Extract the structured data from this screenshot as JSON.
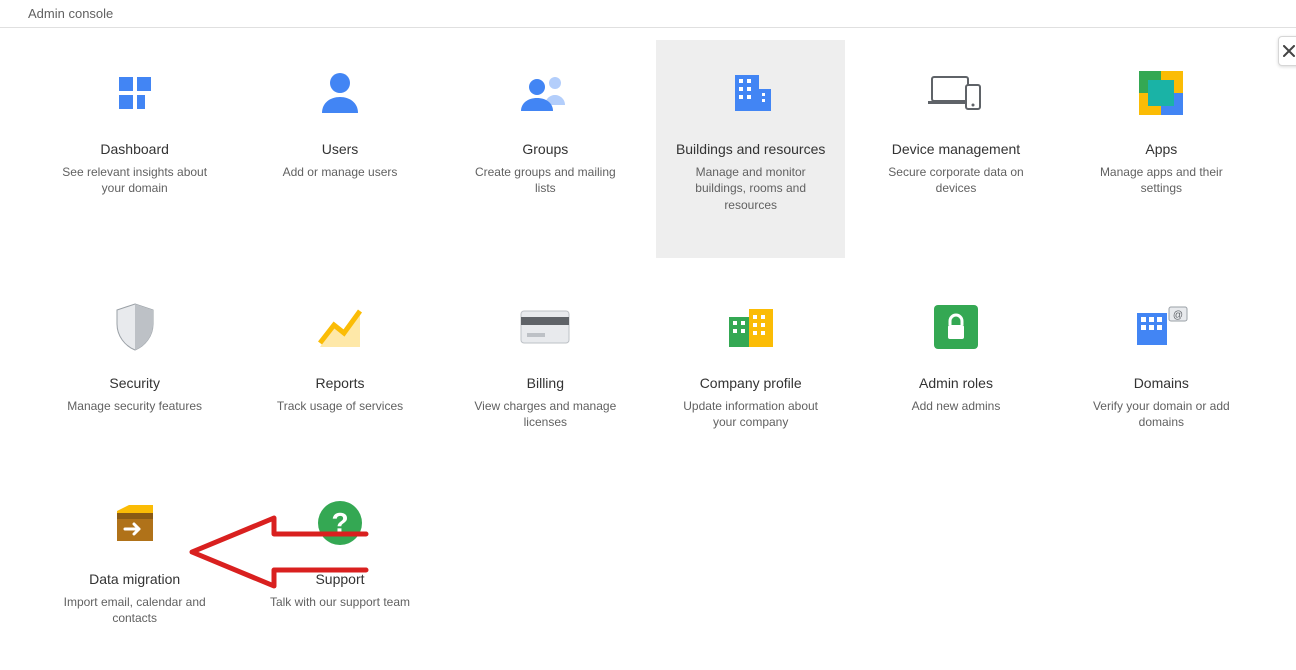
{
  "header": {
    "title": "Admin console"
  },
  "cards": [
    {
      "id": "dashboard",
      "title": "Dashboard",
      "desc": "See relevant insights about your domain",
      "highlight": false
    },
    {
      "id": "users",
      "title": "Users",
      "desc": "Add or manage users",
      "highlight": false
    },
    {
      "id": "groups",
      "title": "Groups",
      "desc": "Create groups and mailing lists",
      "highlight": false
    },
    {
      "id": "buildings",
      "title": "Buildings and resources",
      "desc": "Manage and monitor buildings, rooms and resources",
      "highlight": true
    },
    {
      "id": "device",
      "title": "Device management",
      "desc": "Secure corporate data on devices",
      "highlight": false
    },
    {
      "id": "apps",
      "title": "Apps",
      "desc": "Manage apps and their settings",
      "highlight": false
    },
    {
      "id": "security",
      "title": "Security",
      "desc": "Manage security features",
      "highlight": false
    },
    {
      "id": "reports",
      "title": "Reports",
      "desc": "Track usage of services",
      "highlight": false
    },
    {
      "id": "billing",
      "title": "Billing",
      "desc": "View charges and manage licenses",
      "highlight": false
    },
    {
      "id": "company",
      "title": "Company profile",
      "desc": "Update information about your company",
      "highlight": false
    },
    {
      "id": "adminroles",
      "title": "Admin roles",
      "desc": "Add new admins",
      "highlight": false
    },
    {
      "id": "domains",
      "title": "Domains",
      "desc": "Verify your domain or add domains",
      "highlight": false
    },
    {
      "id": "datamigration",
      "title": "Data migration",
      "desc": "Import email, calendar and contacts",
      "highlight": false
    },
    {
      "id": "support",
      "title": "Support",
      "desc": "Talk with our support team",
      "highlight": false
    }
  ],
  "annotations": {
    "arrow": {
      "color": "#d9201f"
    }
  }
}
